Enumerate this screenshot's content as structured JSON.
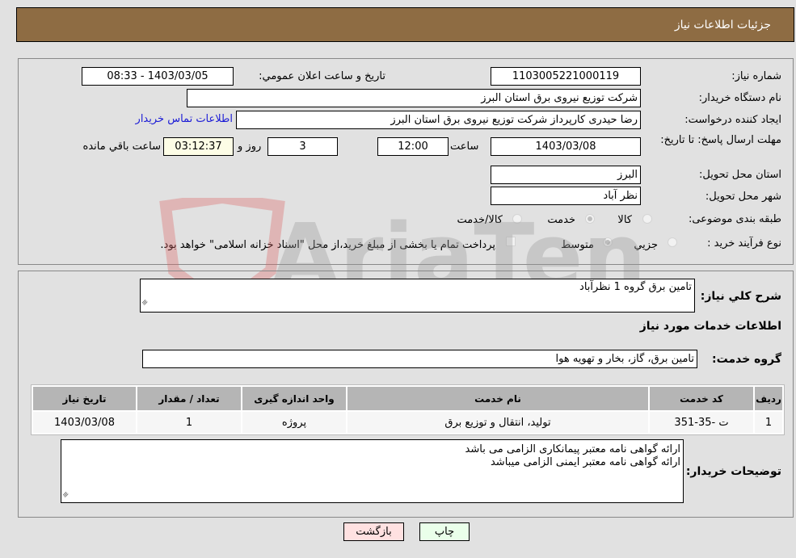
{
  "header": {
    "title": "جزئیات اطلاعات نیاز"
  },
  "details": {
    "need_number_label": "شماره نیاز:",
    "need_number": "1103005221000119",
    "announce_label": "تاریخ و ساعت اعلان عمومي:",
    "announce_value": "1403/03/05 - 08:33",
    "buyer_org_label": "نام دستگاه خريدار:",
    "buyer_org": "شرکت توزیع نیروی برق استان البرز",
    "creator_label": "ایجاد کننده درخواست:",
    "creator": "رضا حیدری کارپرداز شرکت توزیع نیروی برق استان البرز",
    "contact_link": "اطلاعات تماس خریدار",
    "deadline_label": "مهلت ارسال پاسخ: تا تاریخ:",
    "deadline_date": "1403/03/08",
    "time_label": "ساعت",
    "deadline_time": "12:00",
    "days": "3",
    "days_label": "روز و",
    "remaining": "03:12:37",
    "remaining_label": "ساعت باقي مانده",
    "province_label": "استان محل تحویل:",
    "province": "البرز",
    "city_label": "شهر محل تحویل:",
    "city": "نظر آباد",
    "category_label": "طبقه بندی موضوعی:",
    "category_options": [
      {
        "label": "کالا",
        "selected": false
      },
      {
        "label": "خدمت",
        "selected": true
      },
      {
        "label": "کالا/خدمت",
        "selected": false
      }
    ],
    "process_label": "نوع فرآیند خرید :",
    "process_options": [
      {
        "label": "جزيي",
        "selected": false
      },
      {
        "label": "متوسط",
        "selected": true
      }
    ],
    "treasury_note": "پرداخت تمام یا بخشی از مبلغ خرید،از محل \"اسناد خزانه اسلامی\" خواهد بود.",
    "treasury_checked": false
  },
  "summary": {
    "desc_label": "شرح کلي نياز:",
    "desc": "تامین برق گروه 1 نظرآباد",
    "services_heading": "اطلاعات خدمات مورد نياز",
    "group_label": "گروه خدمت:",
    "group": "تامین برق، گاز، بخار و تهویه هوا"
  },
  "table": {
    "headers": [
      "ردیف",
      "کد خدمت",
      "نام خدمت",
      "واحد اندازه گیری",
      "تعداد / مقدار",
      "تاریخ نیاز"
    ],
    "rows": [
      [
        "1",
        "ت -35-351",
        "تولید، انتقال و توزیع برق",
        "پروژه",
        "1",
        "1403/03/08"
      ]
    ]
  },
  "buyer_notes": {
    "label": "توضیحات خریدار:",
    "lines": [
      "ارائه گواهی نامه معتبر پیمانکاری الزامی می باشد",
      "ارائه گواهی نامه معتبر ایمنی الزامی میباشد"
    ]
  },
  "buttons": {
    "print": "چاپ",
    "back": "بازگشت"
  },
  "watermark": {
    "text": "AriaTender.neT"
  },
  "colors": {
    "header_bg": "#8e6c43",
    "page_bg": "#e1e1e1",
    "print_btn": "#eaffea",
    "back_btn": "#ffe1e1",
    "link": "#1b1bd6"
  }
}
